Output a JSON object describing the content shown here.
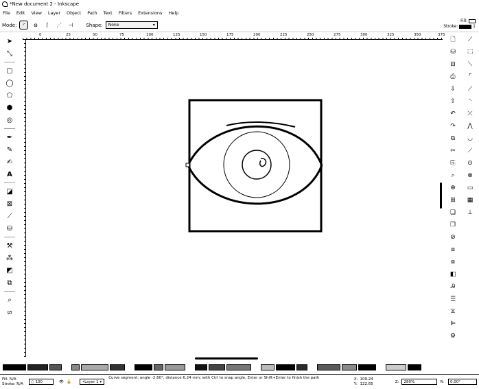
{
  "window": {
    "title": "*New document 2 - Inkscape"
  },
  "menu": [
    "File",
    "Edit",
    "View",
    "Layer",
    "Object",
    "Path",
    "Text",
    "Filters",
    "Extensions",
    "Help"
  ],
  "tool_controls": {
    "mode_label": "Mode:",
    "shape_label": "Shape:",
    "shape_value": "None"
  },
  "fill_stroke": {
    "fill_label": "Fill:",
    "stroke_label": "Stroke:",
    "stroke_value": "1"
  },
  "ruler": {
    "labels": [
      "0",
      "25",
      "50",
      "75",
      "100",
      "125",
      "150",
      "175",
      "200",
      "225",
      "250",
      "275",
      "300",
      "325",
      "350",
      "375"
    ]
  },
  "palette_colors": [
    "#000000",
    "#222222",
    "#555555",
    "#888888",
    "#aaaaaa",
    "#333333",
    "#000000",
    "#666666",
    "#999999",
    "#111111",
    "#444444",
    "#777777",
    "#bbbbbb",
    "#000000",
    "#2a2a2a",
    "#5a5a5a",
    "#8a8a8a",
    "#000000",
    "#cccccc",
    "#000000"
  ],
  "status": {
    "fill_label": "Fill:",
    "fill_value": "N/A",
    "stroke_label": "Stroke:",
    "stroke_value": "N/A",
    "opacity": "100",
    "layer": "•Layer 1",
    "message": "Curve segment: angle -2.60°, distance 6.24 mm; with Ctrl to snap angle, Enter or Shift+Enter to finish the path",
    "x_label": "X:",
    "x_value": "109.24",
    "y_label": "Y:",
    "y_value": "122.65",
    "zoom_label": "Z:",
    "zoom_value": "280%",
    "rotation_label": "R:",
    "rotation_value": "0.00°"
  },
  "icons": {
    "tools": [
      "selector-icon",
      "node-icon",
      "rect-icon",
      "circle-icon",
      "star-icon",
      "3dbox-icon",
      "spiral-icon",
      "pen-icon",
      "pencil-icon",
      "calligraphy-icon",
      "text-icon",
      "gradient-icon",
      "mesh-icon",
      "dropper-icon",
      "paint-bucket-icon",
      "tweak-icon",
      "spray-icon",
      "eraser-icon",
      "connector-icon",
      "zoom-icon",
      "measure-icon"
    ],
    "commands": [
      "new-icon",
      "open-icon",
      "save-icon",
      "print-icon",
      "import-icon",
      "export-icon",
      "undo-icon",
      "redo-icon",
      "copy-icon",
      "cut-icon",
      "paste-icon",
      "zoom-selection-icon",
      "zoom-drawing-icon",
      "zoom-page-icon",
      "duplicate-icon",
      "clone-icon",
      "unlink-icon",
      "group-icon",
      "ungroup-icon",
      "fill-stroke-icon",
      "text-font-icon",
      "layers-icon",
      "xml-editor-icon",
      "align-icon",
      "preferences-icon"
    ],
    "snaps": [
      "snap-toggle-icon",
      "snap-bbox-icon",
      "snap-bbox-edge-icon",
      "snap-bbox-corner-icon",
      "snap-nodes-icon",
      "snap-path-icon",
      "snap-intersection-icon",
      "snap-cusp-icon",
      "snap-smooth-icon",
      "snap-midpoint-icon",
      "snap-center-icon",
      "snap-rotation-icon",
      "snap-page-icon",
      "snap-grid-icon",
      "snap-guide-icon"
    ]
  }
}
